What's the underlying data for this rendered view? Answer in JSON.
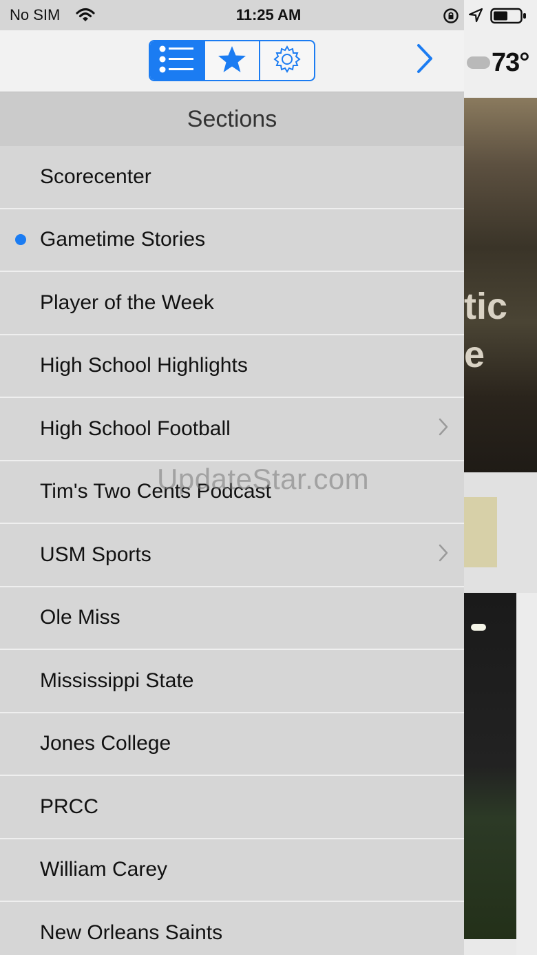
{
  "status_bar": {
    "carrier": "No SIM",
    "time": "11:25 AM",
    "icons": [
      "wifi-icon",
      "rotation-lock-icon",
      "location-icon",
      "battery-icon"
    ]
  },
  "nav": {
    "segments": [
      {
        "icon": "list-icon",
        "active": true
      },
      {
        "icon": "star-icon",
        "active": false
      },
      {
        "icon": "gear-icon",
        "active": false
      }
    ],
    "forward_icon": "chevron-right-icon",
    "accent_color": "#1b7cf2"
  },
  "background": {
    "temperature": "73°",
    "hero_text": "tic\ne"
  },
  "sections": {
    "title": "Sections",
    "items": [
      {
        "label": "Scorecenter",
        "selected": false,
        "has_children": false
      },
      {
        "label": "Gametime Stories",
        "selected": true,
        "has_children": false
      },
      {
        "label": "Player of the Week",
        "selected": false,
        "has_children": false
      },
      {
        "label": "High School Highlights",
        "selected": false,
        "has_children": false
      },
      {
        "label": "High School Football",
        "selected": false,
        "has_children": true
      },
      {
        "label": "Tim's Two Cents Podcast",
        "selected": false,
        "has_children": false
      },
      {
        "label": "USM Sports",
        "selected": false,
        "has_children": true
      },
      {
        "label": "Ole Miss",
        "selected": false,
        "has_children": false
      },
      {
        "label": "Mississippi State",
        "selected": false,
        "has_children": false
      },
      {
        "label": "Jones College",
        "selected": false,
        "has_children": false
      },
      {
        "label": "PRCC",
        "selected": false,
        "has_children": false
      },
      {
        "label": "William Carey",
        "selected": false,
        "has_children": false
      },
      {
        "label": "New Orleans Saints",
        "selected": false,
        "has_children": false
      }
    ]
  },
  "watermark": "UpdateStar.com"
}
